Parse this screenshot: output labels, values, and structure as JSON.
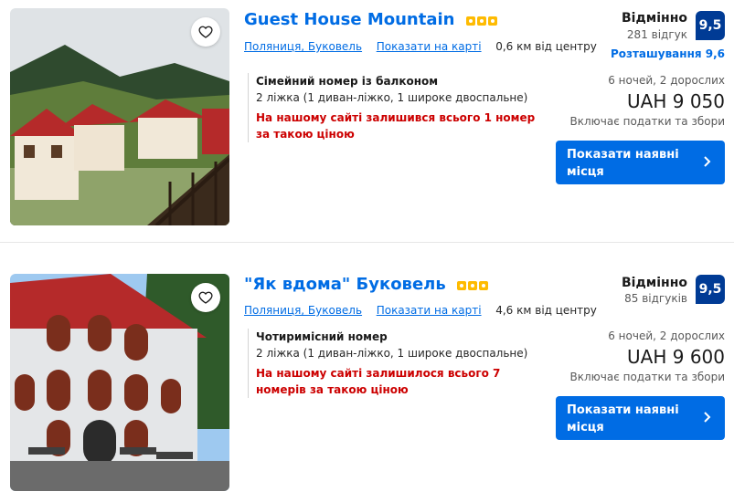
{
  "listings": [
    {
      "title": "Guest House Mountain",
      "location": "Поляниця, Буковель",
      "map_link": "Показати на карті",
      "distance": "0,6 км від центру",
      "room_name": "Сімейний номер із балконом",
      "beds": "2 ліжка (1 диван-ліжко, 1 широке двоспальне)",
      "availability": "На нашому сайті залишився всього 1 номер за такою ціною",
      "rating_word": "Відмінно",
      "reviews": "281 відгук",
      "score": "9,5",
      "location_score": "Розташування 9,6",
      "stay": "6 ночей, 2 дорослих",
      "price": "UAH 9 050",
      "taxes": "Включає податки та збори",
      "cta": "Показати наявні місця"
    },
    {
      "title": "\"Як вдома\" Буковель",
      "location": "Поляниця, Буковель",
      "map_link": "Показати на карті",
      "distance": "4,6 км від центру",
      "room_name": "Чотиримісний номер",
      "beds": "2 ліжка (1 диван-ліжко, 1 широке двоспальне)",
      "availability": "На нашому сайті залишилося всього 7 номерів за такою ціною",
      "rating_word": "Відмінно",
      "reviews": "85 відгуків",
      "score": "9,5",
      "stay": "6 ночей, 2 дорослих",
      "price": "UAH 9 600",
      "taxes": "Включає податки та збори",
      "cta": "Показати наявні місця"
    }
  ],
  "colors": {
    "brand_blue": "#006ce4",
    "score_bg": "#003b95",
    "warning_red": "#cc0000",
    "star": "#febb02"
  },
  "icons": [
    "heart-icon",
    "star-icon",
    "chevron-right-icon"
  ]
}
